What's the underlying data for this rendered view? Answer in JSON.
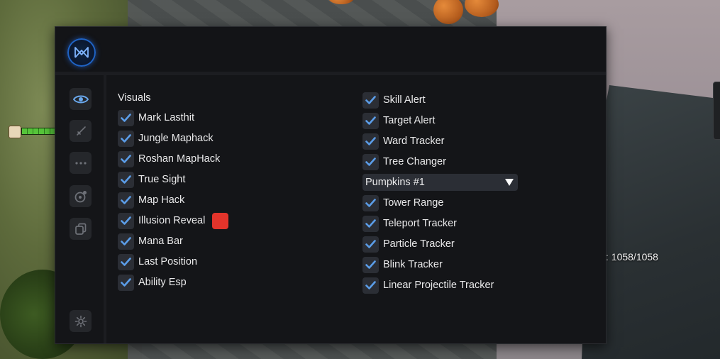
{
  "game": {
    "hp_readout": ": 1058/1058"
  },
  "menu": {
    "logo_icon": "nexus-logo-icon",
    "sidebar": [
      {
        "name": "visuals",
        "icon": "eye-icon",
        "active": true
      },
      {
        "name": "combat",
        "icon": "sword-icon",
        "active": false
      },
      {
        "name": "misc",
        "icon": "more-icon",
        "active": false
      },
      {
        "name": "heroes",
        "icon": "target-icon",
        "active": false
      },
      {
        "name": "items",
        "icon": "copy-icon",
        "active": false
      },
      {
        "name": "settings",
        "icon": "gear-icon",
        "active": false
      }
    ],
    "section_title": "Visuals",
    "left_column": [
      {
        "label": "Mark Lasthit",
        "checked": true
      },
      {
        "label": "Jungle Maphack",
        "checked": true
      },
      {
        "label": "Roshan MapHack",
        "checked": true
      },
      {
        "label": "True Sight",
        "checked": true
      },
      {
        "label": "Map Hack",
        "checked": true
      },
      {
        "label": "Illusion Reveal",
        "checked": true,
        "color": "#e3342b"
      },
      {
        "label": "Mana Bar",
        "checked": true
      },
      {
        "label": "Last Position",
        "checked": true
      },
      {
        "label": "Ability Esp",
        "checked": true
      }
    ],
    "right_column_top": [
      {
        "label": "Skill Alert",
        "checked": true
      },
      {
        "label": "Target Alert",
        "checked": true
      },
      {
        "label": "Ward Tracker",
        "checked": true
      },
      {
        "label": "Tree Changer",
        "checked": true
      }
    ],
    "tree_dropdown": {
      "selected": "Pumpkins #1"
    },
    "right_column_bottom": [
      {
        "label": "Tower Range",
        "checked": true
      },
      {
        "label": "Teleport Tracker",
        "checked": true
      },
      {
        "label": "Particle Tracker",
        "checked": true
      },
      {
        "label": "Blink Tracker",
        "checked": true
      },
      {
        "label": "Linear Projectile Tracker",
        "checked": true
      }
    ]
  },
  "colors": {
    "check": "#5b9de8",
    "panel_bg": "#141518",
    "checkbox_bg": "#2b2e35",
    "accent_logo": "#1f63c4"
  }
}
